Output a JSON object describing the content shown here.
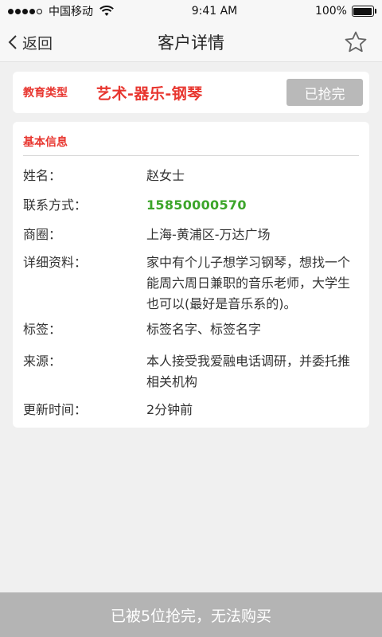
{
  "status_bar": {
    "carrier": "中国移动",
    "time": "9:41 AM",
    "battery": "100%"
  },
  "nav": {
    "back_label": "返回",
    "title": "客户详情"
  },
  "education": {
    "label": "教育类型",
    "value": "艺术-器乐-钢琴",
    "button_label": "已抢完"
  },
  "basic_info": {
    "section_title": "基本信息",
    "rows": [
      {
        "label": "姓名：",
        "value": "赵女士"
      },
      {
        "label": "联系方式：",
        "value": "15850000570"
      },
      {
        "label": "商圈：",
        "value": "上海-黄浦区-万达广场"
      },
      {
        "label": "详细资料：",
        "value": "家中有个儿子想学习钢琴，想找一个能周六周日兼职的音乐老师，大学生也可以(最好是音乐系的)。"
      },
      {
        "label": "标签：",
        "value": "标签名字、标签名字"
      },
      {
        "label": "来源：",
        "value": "本人接受我爱融电话调研，并委托推相关机构"
      },
      {
        "label": "更新时间：",
        "value": "2分钟前"
      }
    ]
  },
  "bottom_bar": {
    "text": "已被5位抢完，无法购买"
  },
  "colors": {
    "accent_red": "#e8362f",
    "phone_green": "#3ca52a",
    "disabled_gray": "#b9b9b9"
  }
}
